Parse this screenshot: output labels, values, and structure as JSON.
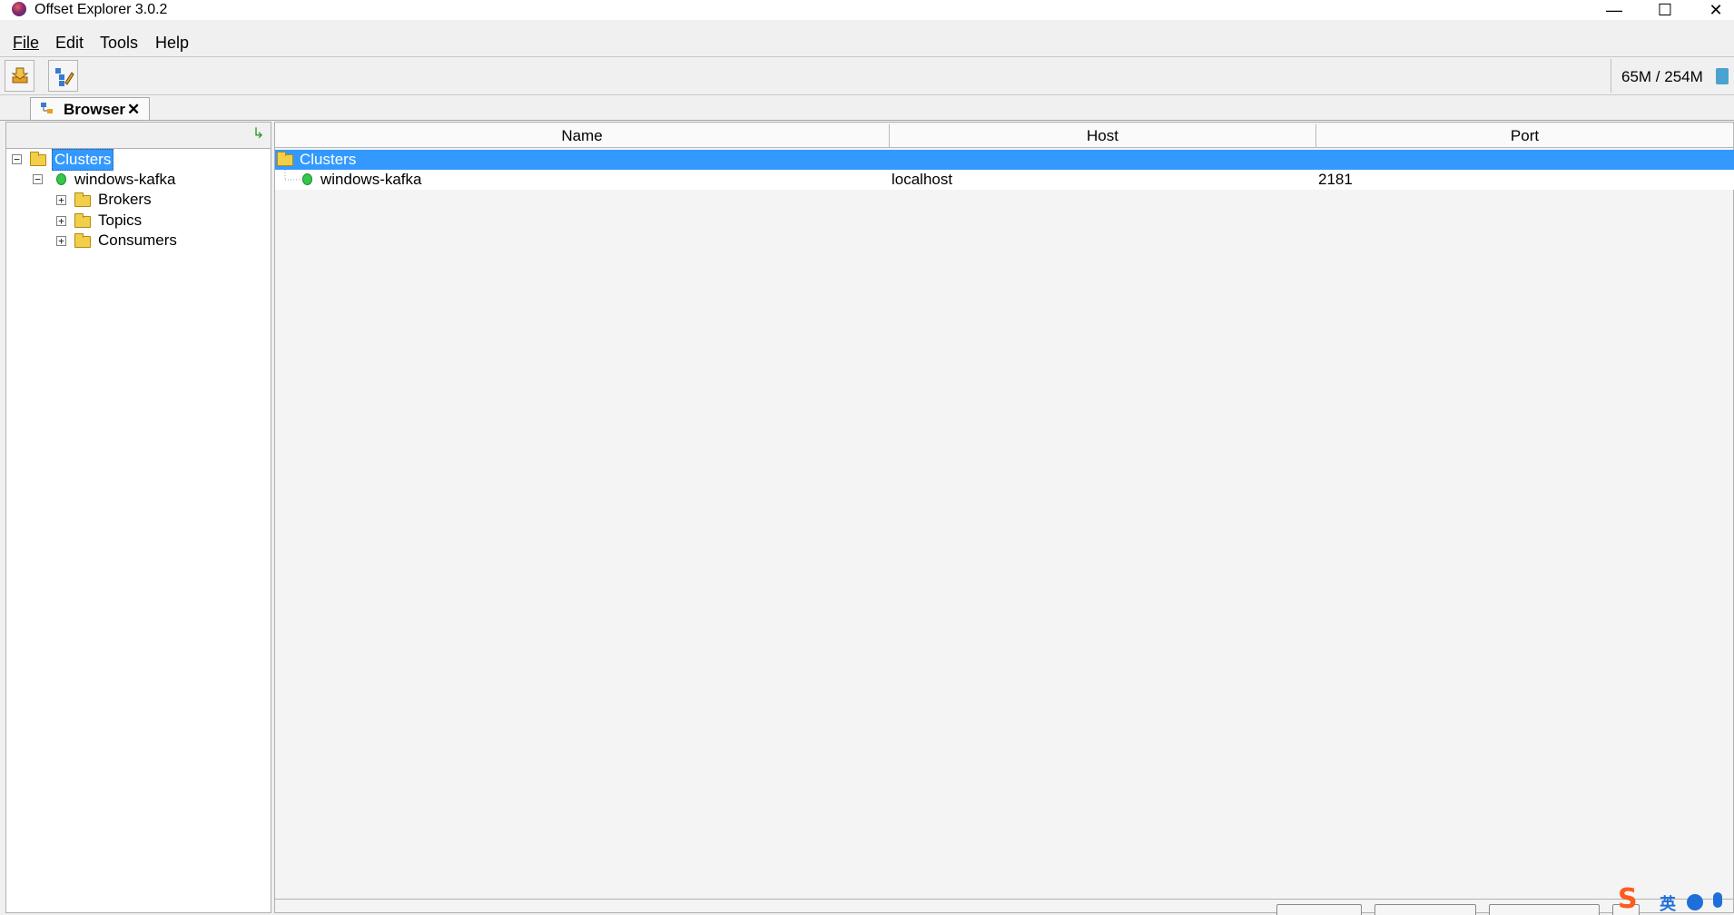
{
  "window": {
    "title": "Offset Explorer  3.0.2",
    "minimize": "—",
    "maximize": "☐",
    "close": "✕"
  },
  "menu": {
    "file": "File",
    "edit": "Edit",
    "tools": "Tools",
    "help": "Help"
  },
  "toolbar": {
    "memory": "65M / 254M"
  },
  "tab": {
    "label": "Browser",
    "close": "✕"
  },
  "tree": {
    "root": "Clusters",
    "cluster": "windows-kafka",
    "children": [
      "Brokers",
      "Topics",
      "Consumers"
    ],
    "collapse_symbol": "−",
    "expand_symbol": "+"
  },
  "table": {
    "columns": [
      "Name",
      "Host",
      "Port"
    ],
    "group_row": "Clusters",
    "rows": [
      {
        "name": "windows-kafka",
        "host": "localhost",
        "port": "2181"
      }
    ]
  },
  "icons": {
    "app": "offset-explorer-icon",
    "connect": "add-connection-icon",
    "edit": "edit-connection-icon",
    "gc": "trash-icon",
    "refresh": "refresh-icon",
    "folder": "folder-icon",
    "status": "connected-status-icon"
  },
  "ime": {
    "logo": "S",
    "lang": "英"
  },
  "colors": {
    "selection": "#3399ff",
    "status_green": "#35c64a",
    "folder_yellow": "#f2cf4a"
  }
}
